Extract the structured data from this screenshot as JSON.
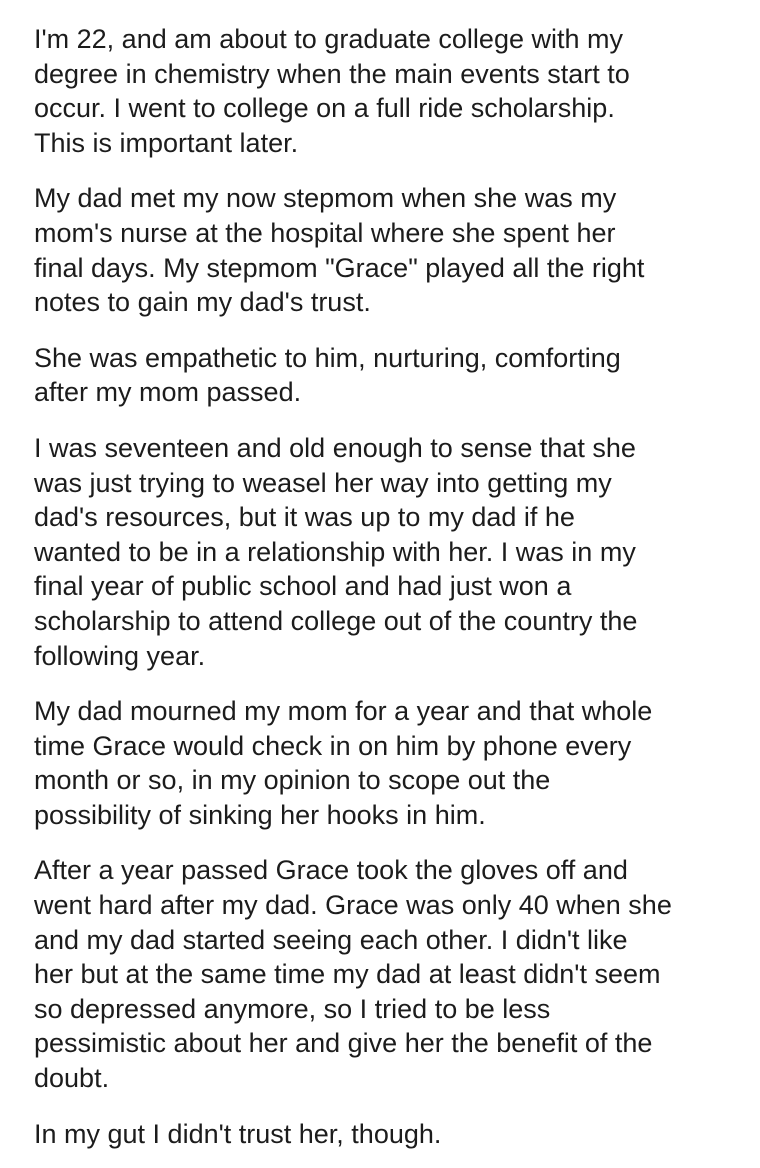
{
  "post": {
    "paragraphs": [
      "I'm 22, and am about to graduate college with my\ndegree in chemistry when the main events start to\noccur. I went to college on a full ride scholarship.\nThis is important later.",
      "My dad met my now stepmom when she was my\nmom's nurse at the hospital where she spent her\nfinal days. My stepmom \"Grace\" played all the right\nnotes to gain my dad's trust.",
      "She was empathetic to him, nurturing, comforting\nafter my mom passed.",
      "I was seventeen and old enough to sense that she\nwas just trying to weasel her way into getting my\ndad's resources, but it was up to my dad if he\nwanted to be in a relationship with her. I was in my\nfinal year of public school and had just won a\nscholarship to attend college out of the country the\nfollowing year.",
      "My dad mourned my mom for a year and that whole\ntime Grace would check in on him by phone every\nmonth or so, in my opinion to scope out the\npossibility of sinking her hooks in him.",
      "After a year passed Grace took the gloves off and\nwent hard after my dad. Grace was only 40 when she\nand my dad started seeing each other. I didn't like\nher but at the same time my dad at least didn't seem\nso depressed anymore, so I tried to be less\npessimistic about her and give her the benefit of the\ndoubt.",
      "In my gut I didn't trust her, though."
    ]
  }
}
